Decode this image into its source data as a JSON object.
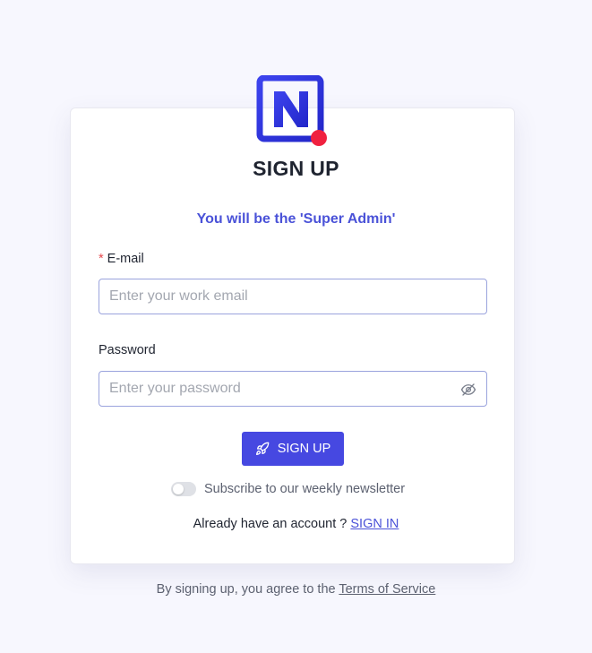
{
  "header": {
    "logo": "n-logo",
    "title": "SIGN UP"
  },
  "form": {
    "subtitle": "You will be the 'Super Admin'",
    "email": {
      "required_mark": "*",
      "label": "E-mail",
      "placeholder": "Enter your work email",
      "value": ""
    },
    "password": {
      "label": "Password",
      "placeholder": "Enter your password",
      "value": "",
      "toggle_icon": "eye-off-icon"
    },
    "submit": {
      "icon": "rocket-icon",
      "label": "SIGN UP"
    },
    "newsletter": {
      "label": "Subscribe to our weekly newsletter",
      "checked": false
    },
    "signin": {
      "prompt": "Already have an account ?",
      "link": "SIGN IN"
    }
  },
  "footer": {
    "text": "By signing up, you agree to the",
    "link": "Terms of Service"
  },
  "colors": {
    "accent": "#4648e1",
    "logo_blue": "#2f35e0",
    "logo_dot": "#f0213f",
    "background": "#f7f7fe"
  }
}
